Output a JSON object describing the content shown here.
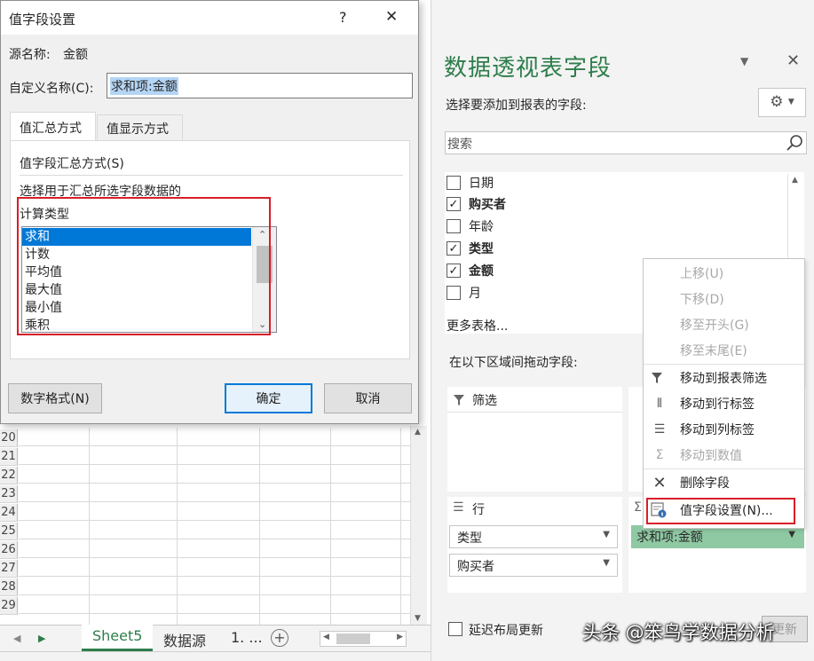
{
  "sheet": {
    "row_numbers": [
      "20",
      "21",
      "22",
      "23",
      "24",
      "25",
      "26",
      "27",
      "28",
      "29"
    ],
    "tabs": {
      "active": "Sheet5",
      "other": "数据源",
      "more": "1. ..."
    }
  },
  "pane": {
    "title": "数据透视表字段",
    "subtitle": "选择要添加到报表的字段:",
    "search_placeholder": "搜索",
    "fields": [
      {
        "label": "日期",
        "checked": false
      },
      {
        "label": "购买者",
        "checked": true
      },
      {
        "label": "年龄",
        "checked": false
      },
      {
        "label": "类型",
        "checked": true
      },
      {
        "label": "金额",
        "checked": true
      },
      {
        "label": "月",
        "checked": false
      }
    ],
    "more_tables": "更多表格...",
    "drag_hint": "在以下区域间拖动字段:",
    "filter_zone": "筛选",
    "rows_zone": "行",
    "row_items": [
      "类型",
      "购买者"
    ],
    "value_item": "求和项:金额",
    "defer_update": "延迟布局更新",
    "update_btn": "更新"
  },
  "context_menu": {
    "items": [
      {
        "label": "上移(U)",
        "icon": "",
        "disabled": true
      },
      {
        "label": "下移(D)",
        "icon": "",
        "disabled": true
      },
      {
        "label": "移至开头(G)",
        "icon": "",
        "disabled": true
      },
      {
        "label": "移至末尾(E)",
        "icon": "",
        "disabled": true
      },
      {
        "label": "移动到报表筛选",
        "icon": "filter-icon",
        "disabled": false
      },
      {
        "label": "移动到行标签",
        "icon": "rows-icon",
        "disabled": false
      },
      {
        "label": "移动到列标签",
        "icon": "columns-icon",
        "disabled": false
      },
      {
        "label": "移动到数值",
        "icon": "sigma-icon",
        "disabled": true
      },
      {
        "label": "删除字段",
        "icon": "delete-icon",
        "disabled": false
      },
      {
        "label": "值字段设置(N)...",
        "icon": "value-settings-icon",
        "disabled": false
      }
    ]
  },
  "dialog": {
    "title": "值字段设置",
    "help": "?",
    "close": "✕",
    "source_label": "源名称:",
    "source_value": "金额",
    "custom_label": "自定义名称(C):",
    "custom_value": "求和项:金额",
    "tabs": [
      "值汇总方式",
      "值显示方式"
    ],
    "section_title": "值字段汇总方式(S)",
    "desc_line1": "选择用于汇总所选字段数据的",
    "desc_line2": "计算类型",
    "calc_types": [
      "求和",
      "计数",
      "平均值",
      "最大值",
      "最小值",
      "乘积"
    ],
    "number_format_btn": "数字格式(N)",
    "ok_btn": "确定",
    "cancel_btn": "取消"
  },
  "watermark": "头条 @笨鸟学数据分析",
  "colors": {
    "accent_green": "#2e7d4b",
    "selection_blue": "#0078d7",
    "highlight_red": "#d81e28",
    "value_zone_green": "#8fc9a3"
  }
}
